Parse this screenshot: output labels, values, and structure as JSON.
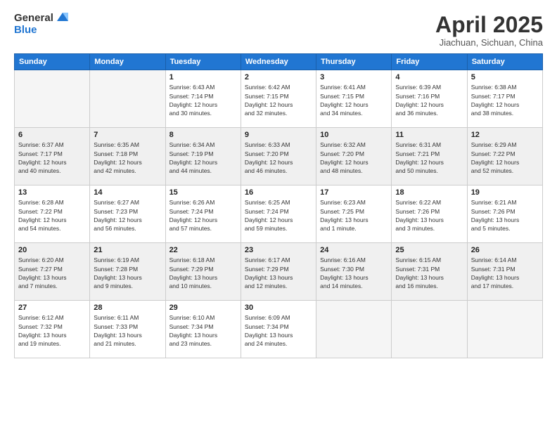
{
  "header": {
    "logo_line1": "General",
    "logo_line2": "Blue",
    "month_title": "April 2025",
    "location": "Jiachuan, Sichuan, China"
  },
  "days_of_week": [
    "Sunday",
    "Monday",
    "Tuesday",
    "Wednesday",
    "Thursday",
    "Friday",
    "Saturday"
  ],
  "weeks": [
    [
      {
        "day": "",
        "info": ""
      },
      {
        "day": "",
        "info": ""
      },
      {
        "day": "1",
        "info": "Sunrise: 6:43 AM\nSunset: 7:14 PM\nDaylight: 12 hours\nand 30 minutes."
      },
      {
        "day": "2",
        "info": "Sunrise: 6:42 AM\nSunset: 7:15 PM\nDaylight: 12 hours\nand 32 minutes."
      },
      {
        "day": "3",
        "info": "Sunrise: 6:41 AM\nSunset: 7:15 PM\nDaylight: 12 hours\nand 34 minutes."
      },
      {
        "day": "4",
        "info": "Sunrise: 6:39 AM\nSunset: 7:16 PM\nDaylight: 12 hours\nand 36 minutes."
      },
      {
        "day": "5",
        "info": "Sunrise: 6:38 AM\nSunset: 7:17 PM\nDaylight: 12 hours\nand 38 minutes."
      }
    ],
    [
      {
        "day": "6",
        "info": "Sunrise: 6:37 AM\nSunset: 7:17 PM\nDaylight: 12 hours\nand 40 minutes."
      },
      {
        "day": "7",
        "info": "Sunrise: 6:35 AM\nSunset: 7:18 PM\nDaylight: 12 hours\nand 42 minutes."
      },
      {
        "day": "8",
        "info": "Sunrise: 6:34 AM\nSunset: 7:19 PM\nDaylight: 12 hours\nand 44 minutes."
      },
      {
        "day": "9",
        "info": "Sunrise: 6:33 AM\nSunset: 7:20 PM\nDaylight: 12 hours\nand 46 minutes."
      },
      {
        "day": "10",
        "info": "Sunrise: 6:32 AM\nSunset: 7:20 PM\nDaylight: 12 hours\nand 48 minutes."
      },
      {
        "day": "11",
        "info": "Sunrise: 6:31 AM\nSunset: 7:21 PM\nDaylight: 12 hours\nand 50 minutes."
      },
      {
        "day": "12",
        "info": "Sunrise: 6:29 AM\nSunset: 7:22 PM\nDaylight: 12 hours\nand 52 minutes."
      }
    ],
    [
      {
        "day": "13",
        "info": "Sunrise: 6:28 AM\nSunset: 7:22 PM\nDaylight: 12 hours\nand 54 minutes."
      },
      {
        "day": "14",
        "info": "Sunrise: 6:27 AM\nSunset: 7:23 PM\nDaylight: 12 hours\nand 56 minutes."
      },
      {
        "day": "15",
        "info": "Sunrise: 6:26 AM\nSunset: 7:24 PM\nDaylight: 12 hours\nand 57 minutes."
      },
      {
        "day": "16",
        "info": "Sunrise: 6:25 AM\nSunset: 7:24 PM\nDaylight: 12 hours\nand 59 minutes."
      },
      {
        "day": "17",
        "info": "Sunrise: 6:23 AM\nSunset: 7:25 PM\nDaylight: 13 hours\nand 1 minute."
      },
      {
        "day": "18",
        "info": "Sunrise: 6:22 AM\nSunset: 7:26 PM\nDaylight: 13 hours\nand 3 minutes."
      },
      {
        "day": "19",
        "info": "Sunrise: 6:21 AM\nSunset: 7:26 PM\nDaylight: 13 hours\nand 5 minutes."
      }
    ],
    [
      {
        "day": "20",
        "info": "Sunrise: 6:20 AM\nSunset: 7:27 PM\nDaylight: 13 hours\nand 7 minutes."
      },
      {
        "day": "21",
        "info": "Sunrise: 6:19 AM\nSunset: 7:28 PM\nDaylight: 13 hours\nand 9 minutes."
      },
      {
        "day": "22",
        "info": "Sunrise: 6:18 AM\nSunset: 7:29 PM\nDaylight: 13 hours\nand 10 minutes."
      },
      {
        "day": "23",
        "info": "Sunrise: 6:17 AM\nSunset: 7:29 PM\nDaylight: 13 hours\nand 12 minutes."
      },
      {
        "day": "24",
        "info": "Sunrise: 6:16 AM\nSunset: 7:30 PM\nDaylight: 13 hours\nand 14 minutes."
      },
      {
        "day": "25",
        "info": "Sunrise: 6:15 AM\nSunset: 7:31 PM\nDaylight: 13 hours\nand 16 minutes."
      },
      {
        "day": "26",
        "info": "Sunrise: 6:14 AM\nSunset: 7:31 PM\nDaylight: 13 hours\nand 17 minutes."
      }
    ],
    [
      {
        "day": "27",
        "info": "Sunrise: 6:12 AM\nSunset: 7:32 PM\nDaylight: 13 hours\nand 19 minutes."
      },
      {
        "day": "28",
        "info": "Sunrise: 6:11 AM\nSunset: 7:33 PM\nDaylight: 13 hours\nand 21 minutes."
      },
      {
        "day": "29",
        "info": "Sunrise: 6:10 AM\nSunset: 7:34 PM\nDaylight: 13 hours\nand 23 minutes."
      },
      {
        "day": "30",
        "info": "Sunrise: 6:09 AM\nSunset: 7:34 PM\nDaylight: 13 hours\nand 24 minutes."
      },
      {
        "day": "",
        "info": ""
      },
      {
        "day": "",
        "info": ""
      },
      {
        "day": "",
        "info": ""
      }
    ]
  ]
}
